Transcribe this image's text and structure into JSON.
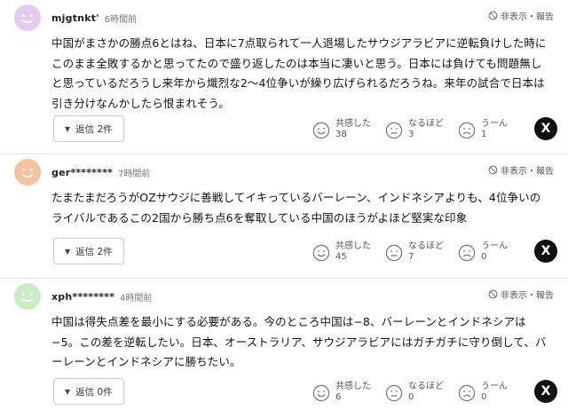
{
  "comments": [
    {
      "user": "mjgtnkt'",
      "time": "6時間前",
      "avatar_color": "#e3ccef",
      "report": "非表示・報告",
      "text": "中国がまさかの勝点6とはね、日本に7点取られて一人退場したサウジアラビアに逆転負けした時にこのまま全敗するかと思ってたので盛り返したのは本当に凄いと思う。日本には負けても問題無しと思っているだろうし来年から熾烈な2〜4位争いが繰り広げられるだろうね。来年の試合で日本は引き分けなんかしたら恨まれそう。",
      "reply": "返信 2件",
      "reactions": [
        {
          "label": "共感した",
          "count": "38",
          "icon": "smile-face-icon"
        },
        {
          "label": "なるほど",
          "count": "3",
          "icon": "thinking-face-icon"
        },
        {
          "label": "うーん",
          "count": "1",
          "icon": "hmm-face-icon"
        }
      ],
      "share": "X"
    },
    {
      "user": "ger********",
      "time": "7時間前",
      "avatar_color": "#f4c29e",
      "report": "非表示・報告",
      "text": "たまたまだろうがOZサウジに善戦してイキっているバーレーン、インドネシアよりも、4位争いのライバルであるこの2国から勝ち点6を奪取している中国のほうがよほど堅実な印象",
      "reply": "返信 2件",
      "reactions": [
        {
          "label": "共感した",
          "count": "45",
          "icon": "smile-face-icon"
        },
        {
          "label": "なるほど",
          "count": "7",
          "icon": "thinking-face-icon"
        },
        {
          "label": "うーん",
          "count": "0",
          "icon": "hmm-face-icon"
        }
      ],
      "share": "X"
    },
    {
      "user": "xph********",
      "time": "4時間前",
      "avatar_color": "#c8ecc3",
      "report": "非表示・報告",
      "text": "中国は得失点差を最小にする必要がある。今のところ中国は−8、バーレーンとインドネシアは−5。この差を逆転したい。日本、オーストラリア、サウジアラビアにはガチガチに守り倒して、バーレーンとインドネシアに勝ちたい。",
      "reply": "返信 0件",
      "reactions": [
        {
          "label": "共感した",
          "count": "6",
          "icon": "smile-face-icon"
        },
        {
          "label": "なるほど",
          "count": "0",
          "icon": "thinking-face-icon"
        },
        {
          "label": "うーん",
          "count": "0",
          "icon": "hmm-face-icon"
        }
      ],
      "share": "X"
    }
  ]
}
